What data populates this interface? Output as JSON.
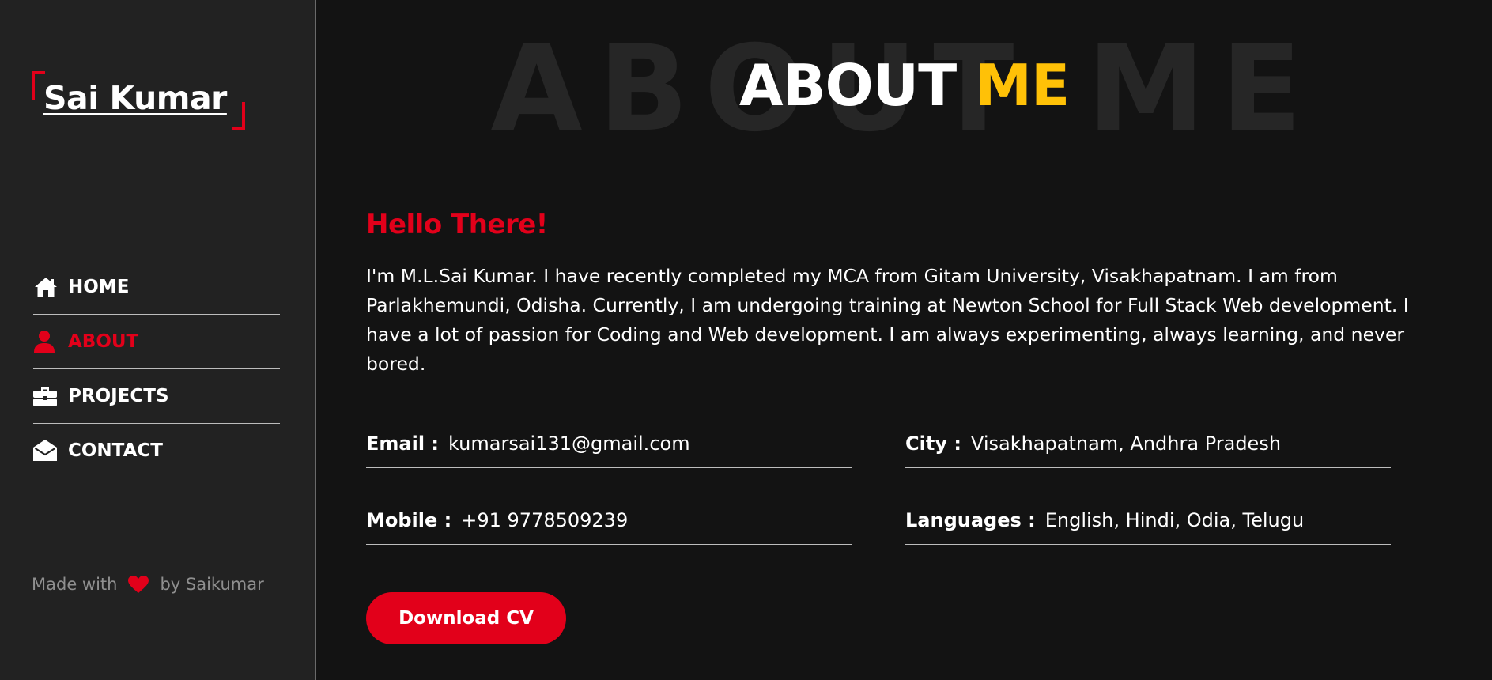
{
  "brand": {
    "name": "Sai Kumar"
  },
  "nav": {
    "items": [
      {
        "label": "HOME",
        "icon": "home-icon"
      },
      {
        "label": "ABOUT",
        "icon": "user-icon"
      },
      {
        "label": "PROJECTS",
        "icon": "briefcase-icon"
      },
      {
        "label": "CONTACT",
        "icon": "envelope-open-icon"
      }
    ],
    "active": "ABOUT"
  },
  "footer": {
    "made_with": "Made with",
    "by": "by Saikumar",
    "icon": "heart-icon"
  },
  "section": {
    "background_title": "ABOUT ME",
    "title_main": "ABOUT",
    "title_accent": "ME"
  },
  "about": {
    "greeting": "Hello There!",
    "bio": "I'm M.L.Sai Kumar. I have recently completed my MCA from Gitam University, Visakhapatnam. I am from Parlakhemundi, Odisha. Currently, I am undergoing training at Newton School for Full Stack Web development. I have a lot of passion for Coding and Web development. I am always experimenting, always learning, and never bored.",
    "info": {
      "email": {
        "label": "Email :",
        "value": "kumarsai131@gmail.com"
      },
      "city": {
        "label": "City :",
        "value": "Visakhapatnam, Andhra Pradesh"
      },
      "mobile": {
        "label": "Mobile :",
        "value": "+91 9778509239"
      },
      "languages": {
        "label": "Languages :",
        "value": "English, Hindi, Odia, Telugu"
      }
    },
    "download_label": "Download CV"
  },
  "colors": {
    "accent_red": "#e2001a",
    "accent_yellow": "#ffc107",
    "sidebar_bg": "#222222",
    "main_bg": "#131313"
  }
}
